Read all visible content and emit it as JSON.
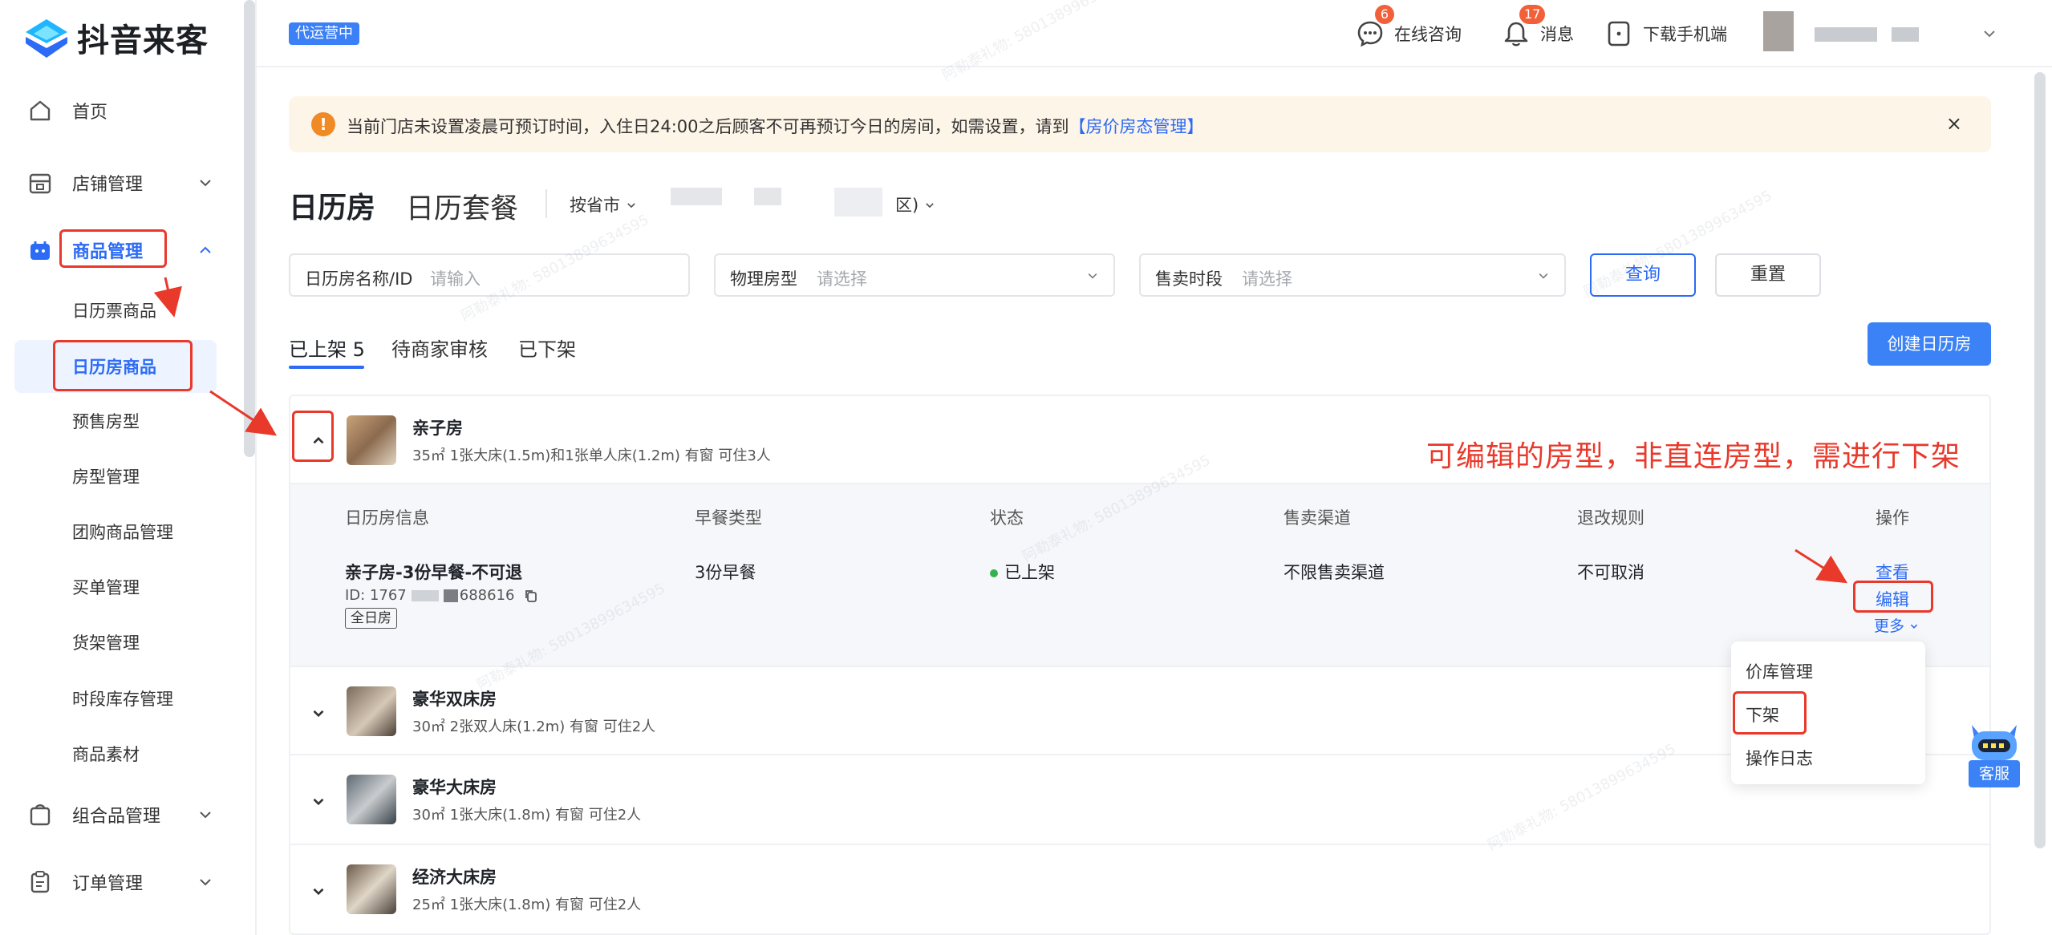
{
  "brand": {
    "name": "抖音来客"
  },
  "sidebar": {
    "items": [
      {
        "label": "首页"
      },
      {
        "label": "店铺管理"
      },
      {
        "label": "商品管理"
      },
      {
        "label": "组合品管理"
      },
      {
        "label": "订单管理"
      }
    ],
    "sub_items": [
      {
        "label": "日历票商品"
      },
      {
        "label": "日历房商品"
      },
      {
        "label": "预售房型"
      },
      {
        "label": "房型管理"
      },
      {
        "label": "团购商品管理"
      },
      {
        "label": "买单管理"
      },
      {
        "label": "货架管理"
      },
      {
        "label": "时段库存管理"
      },
      {
        "label": "商品素材"
      }
    ]
  },
  "header": {
    "status_tag": "代运营中",
    "consult_label": "在线咨询",
    "consult_count": "6",
    "message_label": "消息",
    "message_count": "17",
    "download_label": "下载手机端"
  },
  "alert": {
    "text": "当前门店未设置凌晨可预订时间，入住日24:00之后顾客不可再预订今日的房间，如需设置，请到",
    "link": "【房价房态管理】",
    "close": "×"
  },
  "title": {
    "main": "日历房",
    "secondary": "日历套餐",
    "city_selector": "按省市",
    "city_value": "区)"
  },
  "filters": {
    "name_label": "日历房名称/ID",
    "name_placeholder": "请输入",
    "type_label": "物理房型",
    "type_placeholder": "请选择",
    "period_label": "售卖时段",
    "period_placeholder": "请选择",
    "query": "查询",
    "reset": "重置"
  },
  "tabs": [
    {
      "label": "已上架 5"
    },
    {
      "label": "待商家审核"
    },
    {
      "label": "已下架"
    }
  ],
  "create_button": "创建日历房",
  "rooms": [
    {
      "name": "亲子房",
      "desc": "35㎡   1张大床(1.5m)和1张单人床(1.2m)   有窗   可住3人"
    },
    {
      "name": "豪华双床房",
      "desc": "30㎡   2张双人床(1.2m)   有窗   可住2人"
    },
    {
      "name": "豪华大床房",
      "desc": "30㎡   1张大床(1.8m)   有窗   可住2人"
    },
    {
      "name": "经济大床房",
      "desc": "25㎡   1张大床(1.8m)   有窗   可住2人"
    }
  ],
  "table": {
    "headers": [
      "日历房信息",
      "早餐类型",
      "状态",
      "售卖渠道",
      "退改规则",
      "操作"
    ],
    "row": {
      "name": "亲子房-3份早餐-不可退",
      "id_prefix": "ID: 1767",
      "id_suffix": "688616",
      "tag": "全日房",
      "breakfast": "3份早餐",
      "status": "已上架",
      "channel": "不限售卖渠道",
      "refund": "不可取消",
      "op_view": "查看",
      "op_edit": "编辑",
      "op_more": "更多"
    }
  },
  "more_menu": [
    "价库管理",
    "下架",
    "操作日志"
  ],
  "annotation": "可编辑的房型，非直连房型，需进行下架",
  "customer_service": "客服",
  "watermark": "阿勒泰礼物: 58013899634595",
  "colors": {
    "accent": "#2c6bf5",
    "annotation": "#e8392b",
    "alert_bg": "#fdf5e8",
    "status_green": "#35b24f"
  }
}
